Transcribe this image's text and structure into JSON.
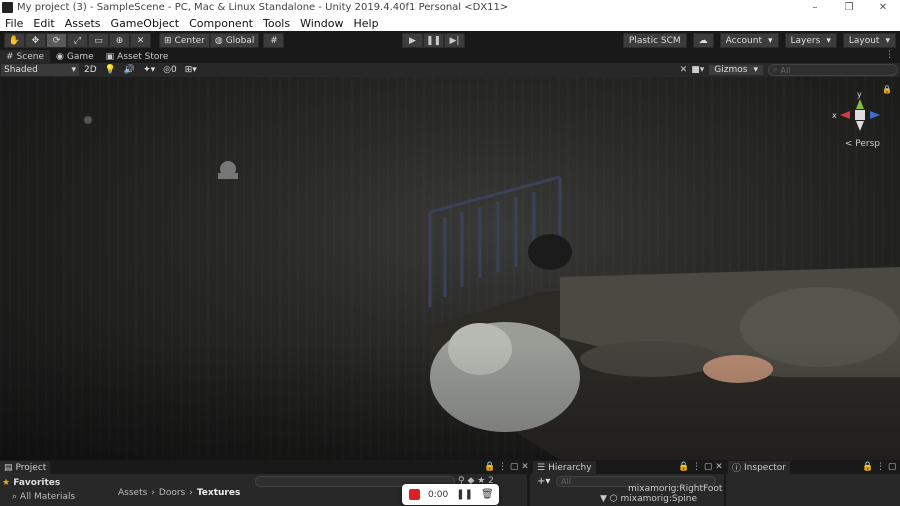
{
  "window": {
    "title": "My project (3) - SampleScene - PC, Mac & Linux Standalone - Unity 2019.4.40f1 Personal <DX11>",
    "controls": [
      "–",
      "❐",
      "✕"
    ]
  },
  "menu": [
    "File",
    "Edit",
    "Assets",
    "GameObject",
    "Component",
    "Tools",
    "Window",
    "Help"
  ],
  "toolbar": {
    "pivot_label": "Center",
    "space_label": "Global",
    "plastic_label": "Plastic SCM",
    "account_label": "Account",
    "layers_label": "Layers",
    "layout_label": "Layout"
  },
  "tabs": {
    "scene": "Scene",
    "game": "Game",
    "asset_store": "Asset Store"
  },
  "scene_toolbar": {
    "shading_mode": "Shaded",
    "mode_2d": "2D",
    "hidden_count": "0",
    "gizmos_label": "Gizmos",
    "search_placeholder": "All"
  },
  "viewport": {
    "persp_label": "< Persp",
    "axis_y": "y",
    "axis_x": "x"
  },
  "project": {
    "tab_label": "Project",
    "favorites_label": "Favorites",
    "all_materials": "All Materials",
    "breadcrumb": [
      "Assets",
      "Doors",
      "Textures"
    ],
    "layer_count": "2"
  },
  "hierarchy": {
    "tab_label": "Hierarchy",
    "search_placeholder": "All",
    "rows": [
      "mixamorig:RightFoot",
      "mixamorig:Spine"
    ]
  },
  "inspector": {
    "tab_label": "Inspector"
  },
  "recorder": {
    "time": "0:00"
  }
}
